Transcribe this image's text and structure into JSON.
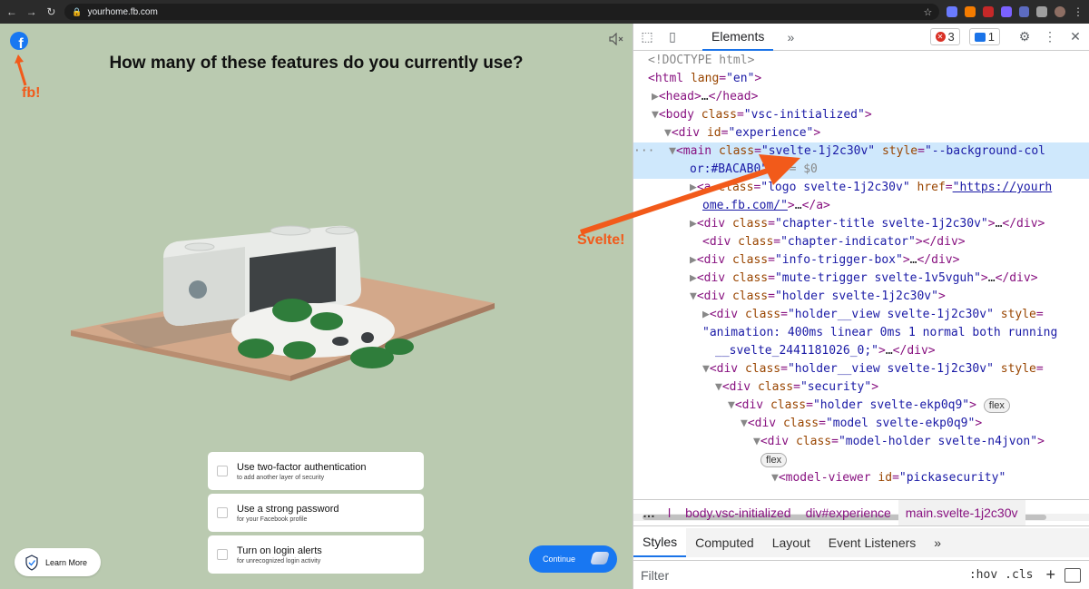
{
  "browser": {
    "url": "yourhome.fb.com"
  },
  "page": {
    "title": "How many of these features do you currently use?",
    "options": [
      {
        "title": "Use two-factor authentication",
        "subtitle": "to add another layer of security"
      },
      {
        "title": "Use a strong password",
        "subtitle": "for your Facebook profile"
      },
      {
        "title": "Turn on login alerts",
        "subtitle": "for unrecognized login activity"
      }
    ],
    "learn_more": "Learn More",
    "continue": "Continue",
    "background_color": "#BACAB0"
  },
  "annotations": {
    "fb": "fb!",
    "svelte": "Svelte!"
  },
  "devtools": {
    "tab": "Elements",
    "errors": "3",
    "messages": "1",
    "breadcrumbs": [
      "l",
      "body.vsc-initialized",
      "div#experience",
      "main.svelte-1j2c30v"
    ],
    "subtabs": [
      "Styles",
      "Computed",
      "Layout",
      "Event Listeners"
    ],
    "filter_placeholder": "Filter",
    "hov": ":hov",
    "cls": ".cls"
  }
}
